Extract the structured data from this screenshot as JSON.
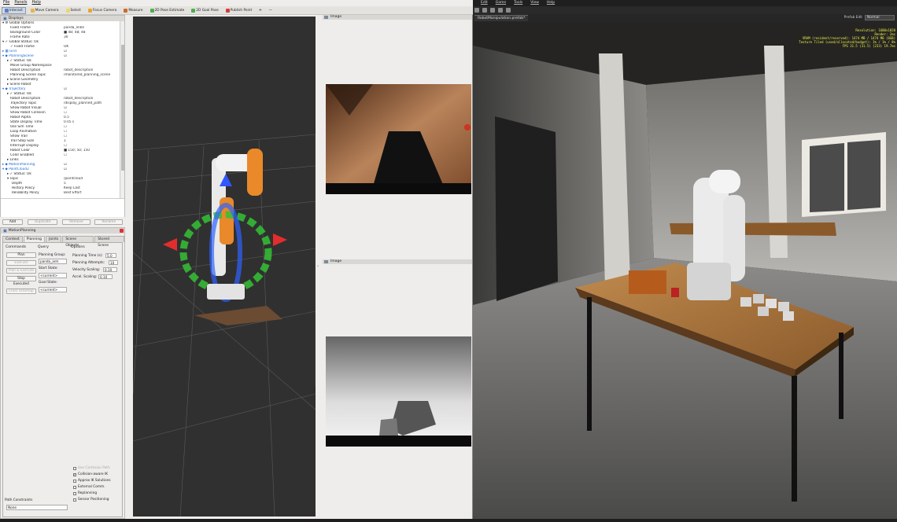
{
  "rviz": {
    "menu": [
      "File",
      "Panels",
      "Help"
    ],
    "toolbar": [
      {
        "label": "Interact",
        "icon": "interact-icon",
        "color": "#5a7fc4"
      },
      {
        "label": "Move Camera",
        "icon": "move-camera-icon",
        "color": "#e7b54a"
      },
      {
        "label": "Select",
        "icon": "select-icon",
        "color": "#e8d773"
      },
      {
        "label": "Focus Camera",
        "icon": "focus-camera-icon",
        "color": "#e4a92b"
      },
      {
        "label": "Measure",
        "icon": "measure-icon",
        "color": "#d16a2c"
      },
      {
        "label": "2D Pose Estimate",
        "icon": "pose-estimate-icon",
        "color": "#4caf50"
      },
      {
        "label": "2D Goal Pose",
        "icon": "goal-pose-icon",
        "color": "#4caf50"
      },
      {
        "label": "Publish Point",
        "icon": "publish-point-icon",
        "color": "#d43b3b"
      }
    ],
    "displays": {
      "title": "Displays",
      "rows": [
        {
          "k": "▾ ⚙ Global Options",
          "v": "",
          "ind": 2
        },
        {
          "k": "Fixed Frame",
          "v": "panda_link0",
          "ind": 12
        },
        {
          "k": "Background Color",
          "v": "■ 48; 48; 48",
          "ind": 12
        },
        {
          "k": "Frame Rate",
          "v": "30",
          "ind": 12
        },
        {
          "k": "▾ ✓ Global Status: Ok",
          "v": "",
          "ind": 2
        },
        {
          "k": "✓ Fixed Frame",
          "v": "OK",
          "ind": 12
        },
        {
          "k": "▸ ▦ Grid",
          "v": "☑",
          "ind": 2,
          "hl": true
        },
        {
          "k": "▾ ◆ PlanningScene",
          "v": "☑",
          "ind": 2,
          "hl": true
        },
        {
          "k": "▸ ✓ Status: Ok",
          "v": "",
          "ind": 8
        },
        {
          "k": "Move Group Namespace",
          "v": "",
          "ind": 12
        },
        {
          "k": "Robot Description",
          "v": "robot_description",
          "ind": 12
        },
        {
          "k": "Planning Scene Topic",
          "v": "/monitored_planning_scene",
          "ind": 12
        },
        {
          "k": "▸ Scene Geometry",
          "v": "",
          "ind": 8
        },
        {
          "k": "▸ Scene Robot",
          "v": "",
          "ind": 8
        },
        {
          "k": "▾ ◆ Trajectory",
          "v": "☑",
          "ind": 2,
          "hl": true
        },
        {
          "k": "▸ ✓ Status: Ok",
          "v": "",
          "ind": 8
        },
        {
          "k": "Robot Description",
          "v": "robot_description",
          "ind": 12
        },
        {
          "k": "Trajectory Topic",
          "v": "/display_planned_path",
          "ind": 12
        },
        {
          "k": "Show Robot Visual",
          "v": "☑",
          "ind": 12
        },
        {
          "k": "Show Robot Collision",
          "v": "☐",
          "ind": 12
        },
        {
          "k": "Robot Alpha",
          "v": "0.5",
          "ind": 12
        },
        {
          "k": "State Display Time",
          "v": "0.05 s",
          "ind": 12
        },
        {
          "k": "Use Sim Time",
          "v": "☐",
          "ind": 12
        },
        {
          "k": "Loop Animation",
          "v": "☐",
          "ind": 12
        },
        {
          "k": "Show Trail",
          "v": "☐",
          "ind": 12
        },
        {
          "k": "Trail Step Size",
          "v": "1",
          "ind": 12
        },
        {
          "k": "Interrupt Display",
          "v": "☐",
          "ind": 12
        },
        {
          "k": "Robot Color",
          "v": "■ 150; 50; 150",
          "ind": 12
        },
        {
          "k": "Color Enabled",
          "v": "☐",
          "ind": 12
        },
        {
          "k": "▸ Links",
          "v": "",
          "ind": 8
        },
        {
          "k": "▸ ◆ MotionPlanning",
          "v": "☑",
          "ind": 2,
          "hl": true
        },
        {
          "k": "▾ ◆ PointCloud2",
          "v": "☑",
          "ind": 2,
          "hl": true
        },
        {
          "k": "▸ ✓ Status: Ok",
          "v": "",
          "ind": 8
        },
        {
          "k": "▾ Topic",
          "v": "/pointcloud",
          "ind": 8
        },
        {
          "k": "Depth",
          "v": "5",
          "ind": 14
        },
        {
          "k": "History Policy",
          "v": "Keep Last",
          "ind": 14
        },
        {
          "k": "Reliability Policy",
          "v": "Best Effort",
          "ind": 14
        }
      ],
      "buttons": [
        "Add",
        "Duplicate",
        "Remove",
        "Rename"
      ]
    },
    "motion_planning": {
      "title": "MotionPlanning",
      "tabs": [
        "Context",
        "Planning",
        "Joints",
        "Scene Objects",
        "Stored Scene"
      ],
      "commands_header": "Commands",
      "query_header": "Query",
      "options_header": "Options",
      "commands": [
        "Plan",
        "Execute",
        "Plan & Execute",
        "Stop"
      ],
      "status_label": "Executed",
      "clear_octomap": "Clear octomap",
      "planning_group_label": "Planning Group:",
      "planning_group_value": "panda_arm",
      "start_state_label": "Start State:",
      "start_state_value": "<current>",
      "goal_state_label": "Goal State:",
      "goal_state_value": "<current>",
      "planning_time_label": "Planning Time (s):",
      "planning_time_value": "5.0",
      "planning_attempts_label": "Planning Attempts:",
      "planning_attempts_value": "10",
      "velocity_scaling_label": "Velocity Scaling:",
      "velocity_scaling_value": "0.10",
      "accel_scaling_label": "Accel. Scaling:",
      "accel_scaling_value": "0.10",
      "checkboxes": [
        {
          "label": "Use Cartesian Path",
          "checked": false,
          "disabled": true
        },
        {
          "label": "Collision-aware IK",
          "checked": true,
          "disabled": false
        },
        {
          "label": "Approx IK Solutions",
          "checked": false,
          "disabled": false
        },
        {
          "label": "External Comm.",
          "checked": false,
          "disabled": false
        },
        {
          "label": "Replanning",
          "checked": false,
          "disabled": false
        },
        {
          "label": "Sensor Positioning",
          "checked": false,
          "disabled": false
        }
      ],
      "path_constraints_label": "Path Constraints",
      "path_constraints_value": "None"
    },
    "image_panels": [
      "Image",
      "Image"
    ]
  },
  "sim": {
    "menu": [
      "Edit",
      "Game",
      "Tools",
      "View",
      "Help"
    ],
    "tab_title": "RobotManipulation.prefab*",
    "profile_label": "Prefab Edit",
    "profile_value": "Normal",
    "hud": [
      "Resolution: 1600x1020",
      "Render: 2ms",
      "VRAM (resident/reserved): 1474 MB / 1474 MB (8GB)",
      "Texture Tiled (used/allocated/budget): 1% / 1% / 8%",
      "FPS 31.5 (31.5) (233) 19.7ms"
    ]
  }
}
